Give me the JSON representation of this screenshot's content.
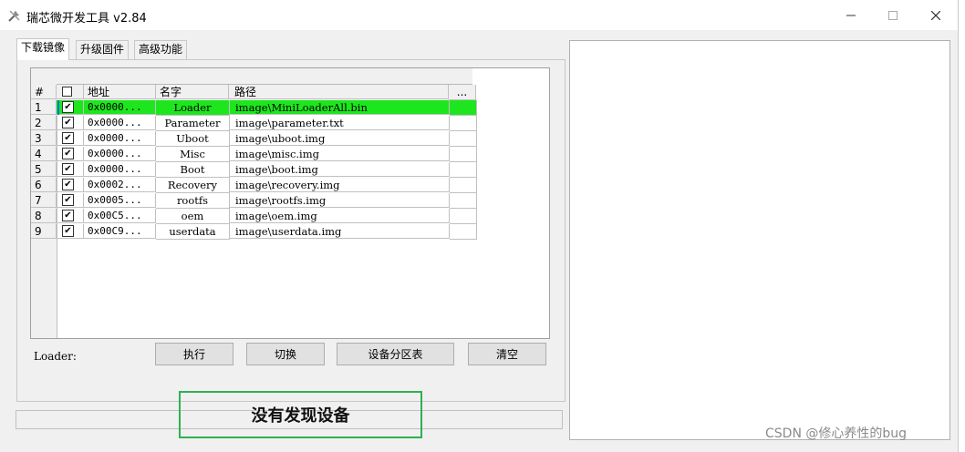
{
  "window": {
    "title": "瑞芯微开发工具 v2.84",
    "min_icon": "minimize-icon",
    "max_icon": "maximize-icon",
    "close_icon": "close-icon"
  },
  "tabs": [
    {
      "label": "下载镜像",
      "active": true
    },
    {
      "label": "升级固件",
      "active": false
    },
    {
      "label": "高级功能",
      "active": false
    }
  ],
  "table": {
    "headers": {
      "num": "#",
      "addr": "地址",
      "name": "名字",
      "path": "路径",
      "more": "..."
    },
    "rows": [
      {
        "num": "1",
        "checked": true,
        "addr": "0x0000...",
        "name": "Loader",
        "path": "image\\MiniLoaderAll.bin",
        "selected": true
      },
      {
        "num": "2",
        "checked": true,
        "addr": "0x0000...",
        "name": "Parameter",
        "path": "image\\parameter.txt",
        "selected": false
      },
      {
        "num": "3",
        "checked": true,
        "addr": "0x0000...",
        "name": "Uboot",
        "path": "image\\uboot.img",
        "selected": false
      },
      {
        "num": "4",
        "checked": true,
        "addr": "0x0000...",
        "name": "Misc",
        "path": "image\\misc.img",
        "selected": false
      },
      {
        "num": "5",
        "checked": true,
        "addr": "0x0000...",
        "name": "Boot",
        "path": "image\\boot.img",
        "selected": false
      },
      {
        "num": "6",
        "checked": true,
        "addr": "0x0002...",
        "name": "Recovery",
        "path": "image\\recovery.img",
        "selected": false
      },
      {
        "num": "7",
        "checked": true,
        "addr": "0x0005...",
        "name": "rootfs",
        "path": "image\\rootfs.img",
        "selected": false
      },
      {
        "num": "8",
        "checked": true,
        "addr": "0x00C5...",
        "name": "oem",
        "path": "image\\oem.img",
        "selected": false
      },
      {
        "num": "9",
        "checked": true,
        "addr": "0x00C9...",
        "name": "userdata",
        "path": "image\\userdata.img",
        "selected": false
      }
    ]
  },
  "loader_label": "Loader:",
  "buttons": {
    "execute": "执行",
    "switch": "切换",
    "partition": "设备分区表",
    "clear": "清空"
  },
  "status": {
    "message": "没有发现设备",
    "highlight_color": "#2fb150"
  },
  "selected_row_color": "#1ee61e",
  "watermark": "CSDN @修心养性的bug"
}
